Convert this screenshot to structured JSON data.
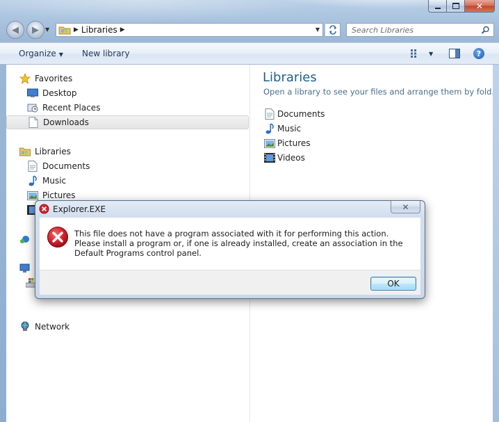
{
  "window": {
    "address": {
      "crumb": "Libraries"
    },
    "search": {
      "placeholder": "Search Libraries"
    }
  },
  "toolbar": {
    "organize_label": "Organize",
    "new_library_label": "New library"
  },
  "nav_pane": {
    "favorites": {
      "label": "Favorites",
      "items": [
        {
          "label": "Desktop",
          "icon": "desktop-icon"
        },
        {
          "label": "Recent Places",
          "icon": "recent-places-icon"
        },
        {
          "label": "Downloads",
          "icon": "downloads-icon",
          "selected": true
        }
      ]
    },
    "libraries": {
      "label": "Libraries",
      "items": [
        {
          "label": "Documents",
          "icon": "documents-icon"
        },
        {
          "label": "Music",
          "icon": "music-icon"
        },
        {
          "label": "Pictures",
          "icon": "pictures-icon"
        }
      ]
    },
    "network": {
      "label": "Network"
    }
  },
  "content": {
    "title": "Libraries",
    "subtitle": "Open a library to see your files and arrange them by fold...",
    "items": [
      {
        "label": "Documents",
        "icon": "documents-icon"
      },
      {
        "label": "Music",
        "icon": "music-icon"
      },
      {
        "label": "Pictures",
        "icon": "pictures-icon"
      },
      {
        "label": "Videos",
        "icon": "videos-icon"
      }
    ]
  },
  "dialog": {
    "title": "Explorer.EXE",
    "message": "This file does not have a program associated with it for performing this action. Please install a program or, if one is already installed, create an association in the Default Programs control panel.",
    "ok_label": "OK"
  },
  "colors": {
    "link_blue": "#1e5f8e",
    "error_red": "#c8202b",
    "frame_blue": "#a9c3df"
  }
}
